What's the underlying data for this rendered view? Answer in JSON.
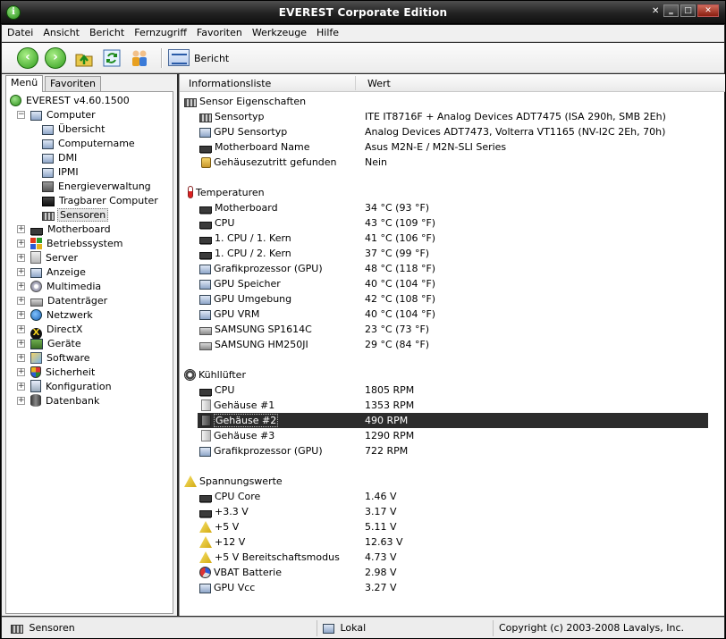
{
  "window": {
    "title": "EVEREST Corporate Edition"
  },
  "menu": [
    {
      "label": "Datei"
    },
    {
      "label": "Ansicht"
    },
    {
      "label": "Bericht"
    },
    {
      "label": "Fernzugriff"
    },
    {
      "label": "Favoriten"
    },
    {
      "label": "Werkzeuge"
    },
    {
      "label": "Hilfe"
    }
  ],
  "toolbar": {
    "report_label": "Bericht"
  },
  "tabs": {
    "menu": "Menü",
    "favorites": "Favoriten"
  },
  "tree": [
    {
      "label": "EVEREST v4.60.1500",
      "icon": "everest-icon"
    },
    {
      "label": "Computer",
      "icon": "computer-icon"
    },
    {
      "label": "Übersicht",
      "icon": "info-icon"
    },
    {
      "label": "Computername",
      "icon": "info-icon"
    },
    {
      "label": "DMI",
      "icon": "info-icon"
    },
    {
      "label": "IPMI",
      "icon": "info-icon"
    },
    {
      "label": "Energieverwaltung",
      "icon": "energy-icon"
    },
    {
      "label": "Tragbarer Computer",
      "icon": "laptop-icon"
    },
    {
      "label": "Sensoren",
      "icon": "sensor-icon"
    },
    {
      "label": "Motherboard",
      "icon": "motherboard-icon"
    },
    {
      "label": "Betriebssystem",
      "icon": "windows-icon"
    },
    {
      "label": "Server",
      "icon": "server-icon"
    },
    {
      "label": "Anzeige",
      "icon": "display-icon"
    },
    {
      "label": "Multimedia",
      "icon": "multimedia-icon"
    },
    {
      "label": "Datenträger",
      "icon": "drive-icon"
    },
    {
      "label": "Netzwerk",
      "icon": "network-icon"
    },
    {
      "label": "DirectX",
      "icon": "directx-icon"
    },
    {
      "label": "Geräte",
      "icon": "devices-icon"
    },
    {
      "label": "Software",
      "icon": "software-icon"
    },
    {
      "label": "Sicherheit",
      "icon": "security-icon"
    },
    {
      "label": "Konfiguration",
      "icon": "config-icon"
    },
    {
      "label": "Datenbank",
      "icon": "database-icon"
    }
  ],
  "columns": {
    "field": "Informationsliste",
    "value": "Wert"
  },
  "groups": [
    {
      "label": "Sensor Eigenschaften",
      "icon": "sensor-icon",
      "rows": [
        {
          "label": "Sensortyp",
          "value": "ITE IT8716F + Analog Devices ADT7475  (ISA 290h, SMB 2Eh)",
          "icon": "sensor-icon"
        },
        {
          "label": "GPU Sensortyp",
          "value": "Analog Devices ADT7473, Volterra VT1165  (NV-I2C 2Eh, 70h)",
          "icon": "display-icon"
        },
        {
          "label": "Motherboard Name",
          "value": "Asus M2N-E / M2N-SLI Series",
          "icon": "motherboard-icon"
        },
        {
          "label": "Gehäusezutritt gefunden",
          "value": "Nein",
          "icon": "lock-icon"
        }
      ]
    },
    {
      "label": "Temperaturen",
      "icon": "thermometer-icon",
      "rows": [
        {
          "label": "Motherboard",
          "value": "34 °C  (93 °F)",
          "icon": "motherboard-icon"
        },
        {
          "label": "CPU",
          "value": "43 °C  (109 °F)",
          "icon": "cpu-icon"
        },
        {
          "label": "1. CPU / 1. Kern",
          "value": "41 °C  (106 °F)",
          "icon": "cpu-icon"
        },
        {
          "label": "1. CPU / 2. Kern",
          "value": "37 °C  (99 °F)",
          "icon": "cpu-icon"
        },
        {
          "label": "Grafikprozessor (GPU)",
          "value": "48 °C  (118 °F)",
          "icon": "display-icon"
        },
        {
          "label": "GPU Speicher",
          "value": "40 °C  (104 °F)",
          "icon": "display-icon"
        },
        {
          "label": "GPU Umgebung",
          "value": "42 °C  (108 °F)",
          "icon": "display-icon"
        },
        {
          "label": "GPU VRM",
          "value": "40 °C  (104 °F)",
          "icon": "display-icon"
        },
        {
          "label": "SAMSUNG SP1614C",
          "value": "23 °C  (73 °F)",
          "icon": "drive-icon"
        },
        {
          "label": "SAMSUNG HM250JI",
          "value": "29 °C  (84 °F)",
          "icon": "drive-icon"
        }
      ]
    },
    {
      "label": "Kühllüfter",
      "icon": "fan-icon",
      "rows": [
        {
          "label": "CPU",
          "value": "1805 RPM",
          "icon": "cpu-icon"
        },
        {
          "label": "Gehäuse #1",
          "value": "1353 RPM",
          "icon": "case-icon"
        },
        {
          "label": "Gehäuse #2",
          "value": "490 RPM",
          "icon": "case-icon",
          "selected": true
        },
        {
          "label": "Gehäuse #3",
          "value": "1290 RPM",
          "icon": "case-icon"
        },
        {
          "label": "Grafikprozessor (GPU)",
          "value": "722 RPM",
          "icon": "display-icon"
        }
      ]
    },
    {
      "label": "Spannungswerte",
      "icon": "voltage-icon",
      "rows": [
        {
          "label": "CPU Core",
          "value": "1.46 V",
          "icon": "cpu-icon"
        },
        {
          "label": "+3.3 V",
          "value": "3.17 V",
          "icon": "cpu-icon"
        },
        {
          "label": "+5 V",
          "value": "5.11 V",
          "icon": "voltage-icon"
        },
        {
          "label": "+12 V",
          "value": "12.63 V",
          "icon": "voltage-icon"
        },
        {
          "label": "+5 V Bereitschaftsmodus",
          "value": "4.73 V",
          "icon": "voltage-icon"
        },
        {
          "label": "VBAT Batterie",
          "value": "2.98 V",
          "icon": "battery-icon"
        },
        {
          "label": "GPU Vcc",
          "value": "3.27 V",
          "icon": "display-icon"
        }
      ]
    }
  ],
  "status": {
    "left": "Sensoren",
    "middle": "Lokal",
    "right": "Copyright (c) 2003-2008 Lavalys, Inc."
  }
}
